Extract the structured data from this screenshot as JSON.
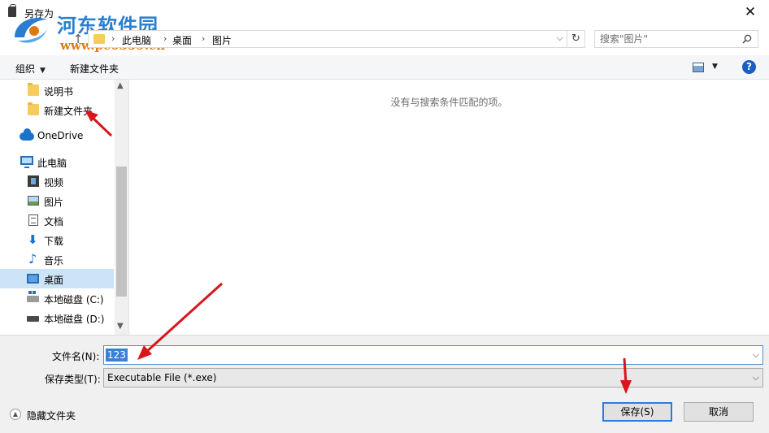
{
  "window": {
    "title": "另存为",
    "close_glyph": "✕"
  },
  "watermark": {
    "title": "河东软件园",
    "url": "www.pc0359.cn"
  },
  "address": {
    "up_glyph": "↑",
    "segments": [
      "此电脑",
      "桌面",
      "图片"
    ],
    "refresh_glyph": "↻"
  },
  "search": {
    "placeholder": "搜索\"图片\""
  },
  "toolbar": {
    "organize_label": "组织",
    "new_folder_label": "新建文件夹",
    "help_glyph": "?"
  },
  "nav": {
    "items": [
      {
        "label": "说明书",
        "icon": "folder-icon"
      },
      {
        "label": "新建文件夹",
        "icon": "folder-icon"
      },
      {
        "label": "OneDrive",
        "icon": "cloud-icon"
      },
      {
        "label": "此电脑",
        "icon": "computer-icon"
      },
      {
        "label": "视频",
        "icon": "video-icon"
      },
      {
        "label": "图片",
        "icon": "picture-icon"
      },
      {
        "label": "文档",
        "icon": "document-icon"
      },
      {
        "label": "下载",
        "icon": "download-icon"
      },
      {
        "label": "音乐",
        "icon": "music-icon"
      },
      {
        "label": "桌面",
        "icon": "desktop-icon",
        "selected": true
      },
      {
        "label": "本地磁盘 (C:)",
        "icon": "drive-icon"
      },
      {
        "label": "本地磁盘 (D:)",
        "icon": "drive-icon"
      }
    ]
  },
  "content": {
    "empty_message": "没有与搜索条件匹配的项。"
  },
  "form": {
    "filename_label": "文件名(N):",
    "filename_value": "123",
    "filetype_label": "保存类型(T):",
    "filetype_value": "Executable File (*.exe)",
    "hide_folders_label": "隐藏文件夹",
    "save_label": "保存(S)",
    "cancel_label": "取消"
  },
  "colors": {
    "accent": "#2d7be0",
    "selection": "#cce4f7",
    "annotation_arrow": "#d8161b"
  }
}
